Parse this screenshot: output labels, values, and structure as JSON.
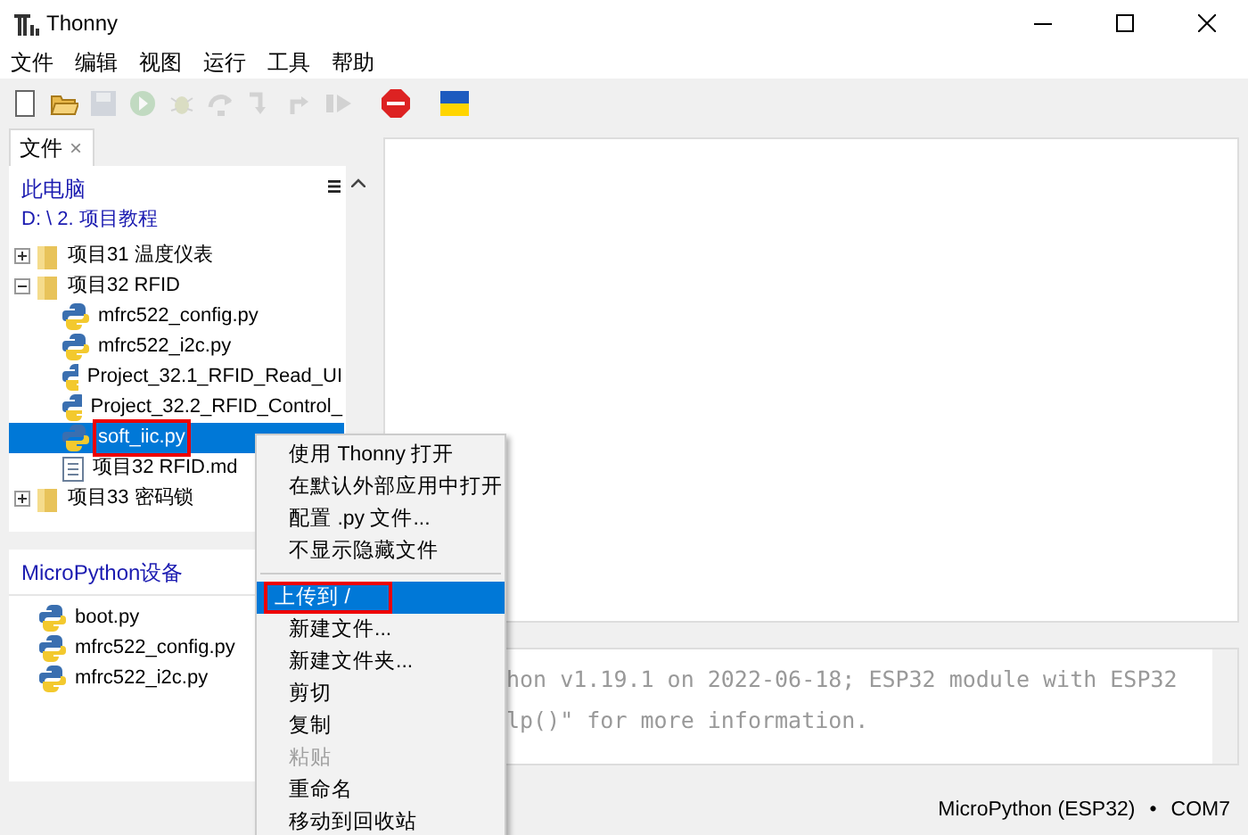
{
  "window": {
    "title": "Thonny"
  },
  "menu": [
    "文件",
    "编辑",
    "视图",
    "运行",
    "工具",
    "帮助"
  ],
  "toolbar": [
    {
      "kind": "new",
      "disabled": false
    },
    {
      "kind": "open",
      "disabled": false
    },
    {
      "kind": "save",
      "disabled": true
    },
    {
      "kind": "run",
      "disabled": true
    },
    {
      "kind": "debug",
      "disabled": true
    },
    {
      "kind": "step-over",
      "disabled": true
    },
    {
      "kind": "step-into",
      "disabled": true
    },
    {
      "kind": "step-out",
      "disabled": true
    },
    {
      "kind": "resume",
      "disabled": true
    },
    {
      "kind": "stop",
      "disabled": false
    },
    {
      "kind": "flag",
      "disabled": false
    }
  ],
  "files_panel": {
    "tab": "文件",
    "tab_close": "×",
    "computer": {
      "title": "此电脑",
      "path": "D: \\ 2. 项目教程",
      "tree": [
        {
          "label": "项目31 温度仪表",
          "kind": "folder",
          "expanded": false,
          "selected": false,
          "highlighted": false
        },
        {
          "label": "项目32 RFID",
          "kind": "folder",
          "expanded": true,
          "selected": false,
          "highlighted": false,
          "children": [
            {
              "label": "mfrc522_config.py",
              "kind": "python",
              "selected": false,
              "highlighted": false
            },
            {
              "label": "mfrc522_i2c.py",
              "kind": "python",
              "selected": false,
              "highlighted": false
            },
            {
              "label": "Project_32.1_RFID_Read_UI",
              "kind": "python",
              "selected": false,
              "highlighted": false
            },
            {
              "label": "Project_32.2_RFID_Control_",
              "kind": "python",
              "selected": false,
              "highlighted": false
            },
            {
              "label": "soft_iic.py",
              "kind": "python",
              "selected": true,
              "highlighted": true
            },
            {
              "label": "项目32 RFID.md",
              "kind": "markdown",
              "selected": false,
              "highlighted": false
            }
          ]
        },
        {
          "label": "项目33 密码锁",
          "kind": "folder",
          "expanded": false,
          "selected": false,
          "highlighted": false
        }
      ]
    },
    "device": {
      "title": "MicroPython设备",
      "files": [
        {
          "label": "boot.py",
          "kind": "python"
        },
        {
          "label": "mfrc522_config.py",
          "kind": "python"
        },
        {
          "label": "mfrc522_i2c.py",
          "kind": "python"
        }
      ]
    }
  },
  "context_menu": {
    "items": [
      {
        "kind": "item",
        "label": "使用 Thonny 打开",
        "disabled": false,
        "selected": false,
        "highlighted": false
      },
      {
        "kind": "item",
        "label": "在默认外部应用中打开",
        "disabled": false,
        "selected": false,
        "highlighted": false
      },
      {
        "kind": "item",
        "label": "配置 .py 文件...",
        "disabled": false,
        "selected": false,
        "highlighted": false
      },
      {
        "kind": "item",
        "label": "不显示隐藏文件",
        "disabled": false,
        "selected": false,
        "highlighted": false
      },
      {
        "kind": "separator"
      },
      {
        "kind": "item",
        "label": "上传到 /",
        "disabled": false,
        "selected": true,
        "highlighted": true
      },
      {
        "kind": "item",
        "label": "新建文件...",
        "disabled": false,
        "selected": false,
        "highlighted": false
      },
      {
        "kind": "item",
        "label": "新建文件夹...",
        "disabled": false,
        "selected": false,
        "highlighted": false
      },
      {
        "kind": "item",
        "label": "剪切",
        "disabled": false,
        "selected": false,
        "highlighted": false
      },
      {
        "kind": "item",
        "label": "复制",
        "disabled": false,
        "selected": false,
        "highlighted": false
      },
      {
        "kind": "item",
        "label": "粘贴",
        "disabled": true,
        "selected": false,
        "highlighted": false
      },
      {
        "kind": "item",
        "label": "重命名",
        "disabled": false,
        "selected": false,
        "highlighted": false
      },
      {
        "kind": "item",
        "label": "移动到回收站",
        "disabled": false,
        "selected": false,
        "highlighted": false
      }
    ]
  },
  "shell": {
    "lines": [
      "hon v1.19.1 on 2022-06-18; ESP32 module with ESP32",
      "lp()\" for more information."
    ]
  },
  "status_bar": {
    "interpreter": "MicroPython (ESP32)",
    "separator": "•",
    "port": "COM7"
  }
}
